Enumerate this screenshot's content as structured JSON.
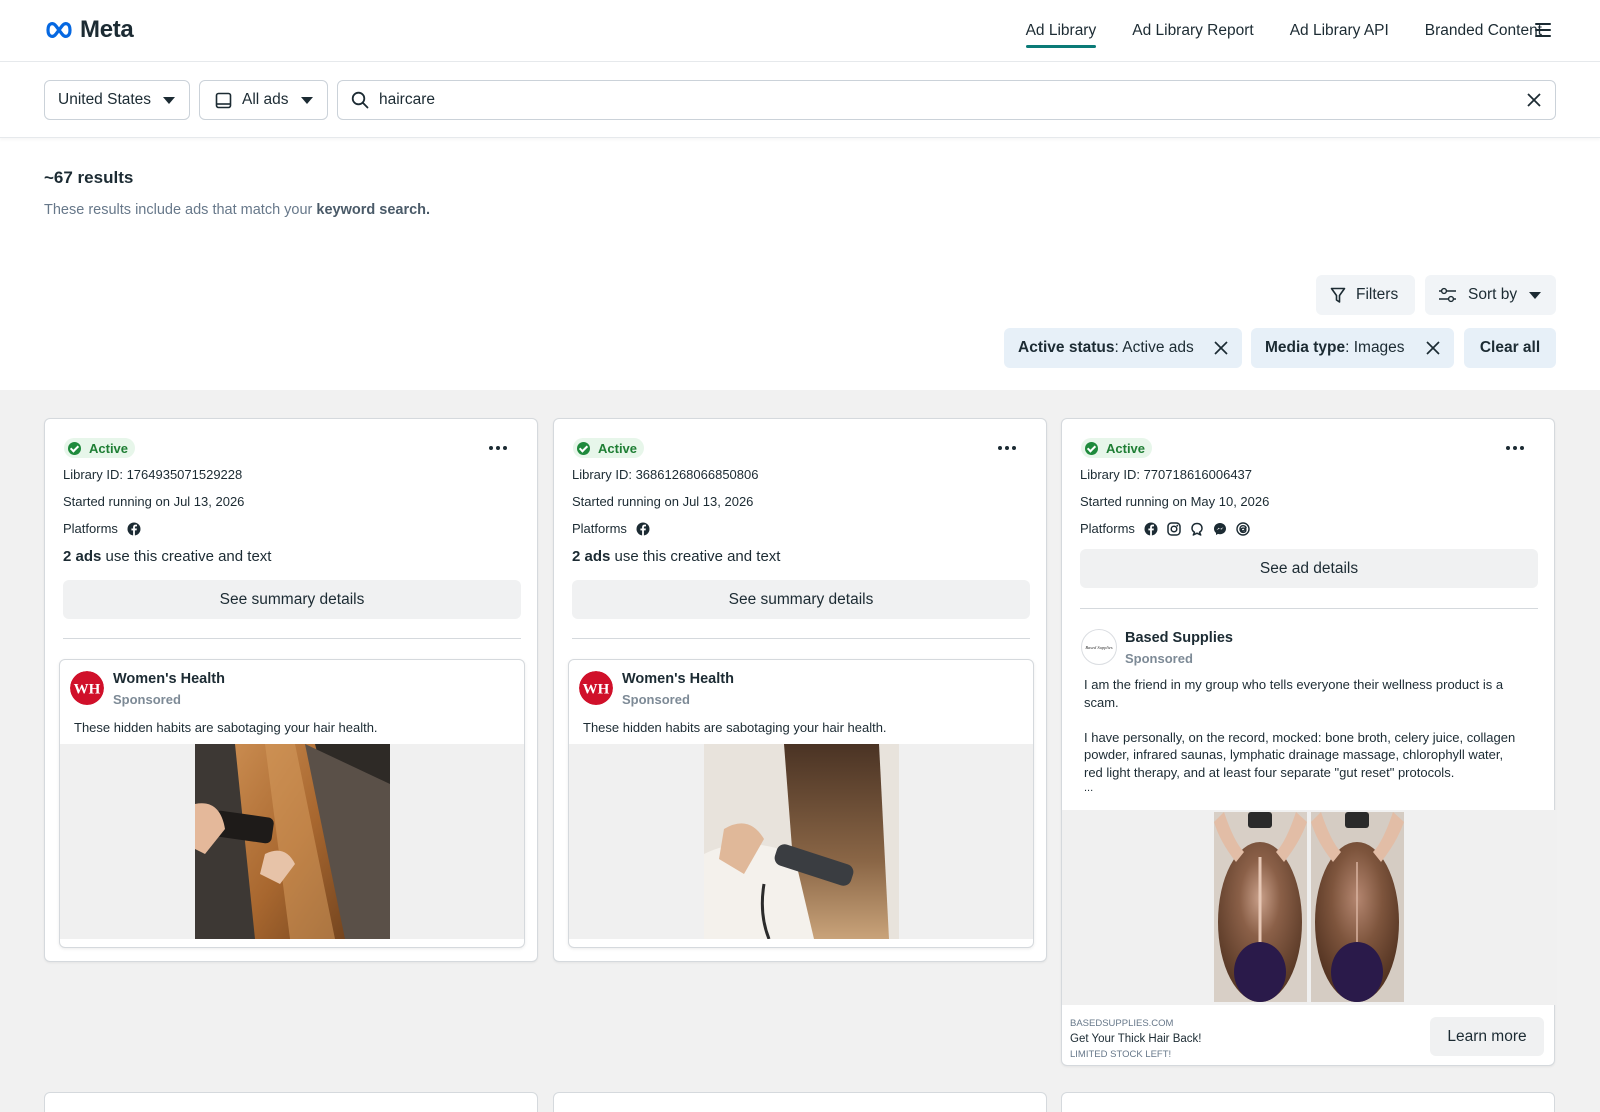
{
  "brand": {
    "logo_text": "Meta"
  },
  "nav": {
    "links": [
      "Ad Library",
      "Ad Library Report",
      "Ad Library API",
      "Branded Content"
    ],
    "active_index": 0
  },
  "search": {
    "country": "United States",
    "ad_type": "All ads",
    "query": "haircare"
  },
  "results": {
    "count_label": "~67 results",
    "note_prefix": "These results include ads that match your",
    "note_bold": "keyword search."
  },
  "toolbar": {
    "filters_label": "Filters",
    "sort_label": "Sort by"
  },
  "filter_chips": [
    {
      "key": "Active status",
      "value": ": Active ads"
    },
    {
      "key": "Media type",
      "value": ": Images"
    }
  ],
  "clear_all_label": "Clear all",
  "cards": [
    {
      "status": "Active",
      "library_id": "Library ID: 1764935071529228",
      "started": "Started running on Jul 13, 2026",
      "platforms_label": "Platforms",
      "platforms": [
        "facebook-icon"
      ],
      "ads_count": "2 ads",
      "ads_suffix": " use this creative and text",
      "button_label": "See summary details",
      "advertiser": "Women's Health",
      "sponsored": "Sponsored",
      "body": "These hidden habits are sabotaging your hair health.",
      "avatar_text": "WH"
    },
    {
      "status": "Active",
      "library_id": "Library ID: 36861268066850806",
      "started": "Started running on Jul 13, 2026",
      "platforms_label": "Platforms",
      "platforms": [
        "facebook-icon"
      ],
      "ads_count": "2 ads",
      "ads_suffix": " use this creative and text",
      "button_label": "See summary details",
      "advertiser": "Women's Health",
      "sponsored": "Sponsored",
      "body": "These hidden habits are sabotaging your hair health.",
      "avatar_text": "WH"
    },
    {
      "status": "Active",
      "library_id": "Library ID: 770718616006437",
      "started": "Started running on May 10, 2026",
      "platforms_label": "Platforms",
      "platforms": [
        "facebook-icon",
        "instagram-icon",
        "audience-network-icon",
        "messenger-icon",
        "threads-icon"
      ],
      "button_label": "See ad details",
      "advertiser": "Based Supplies",
      "sponsored": "Sponsored",
      "body_p1_line1": "I am the friend in my group who tells everyone their wellness product is a",
      "body_p1_line2": "scam.",
      "body_p2_line1": "I have personally, on the record, mocked: bone broth, celery juice, collagen",
      "body_p2_line2": "powder, infrared saunas, lymphatic drainage massage, chlorophyll water,",
      "body_p2_line3": "red light therapy, and at least four separate \"gut reset\" protocols.",
      "ellipsis": "...",
      "domain": "BASEDSUPPLIES.COM",
      "headline": "Get Your Thick Hair Back!",
      "caption": "LIMITED STOCK LEFT!",
      "cta_label": "Learn more",
      "avatar_text": "Based Supplies"
    }
  ],
  "colors": {
    "accent_teal": "#0a7a77",
    "active_green": "#1e8a3c",
    "chip_bg": "#e7f0f8",
    "wh_red": "#d0102a",
    "meta_blue": "#0668e1"
  }
}
